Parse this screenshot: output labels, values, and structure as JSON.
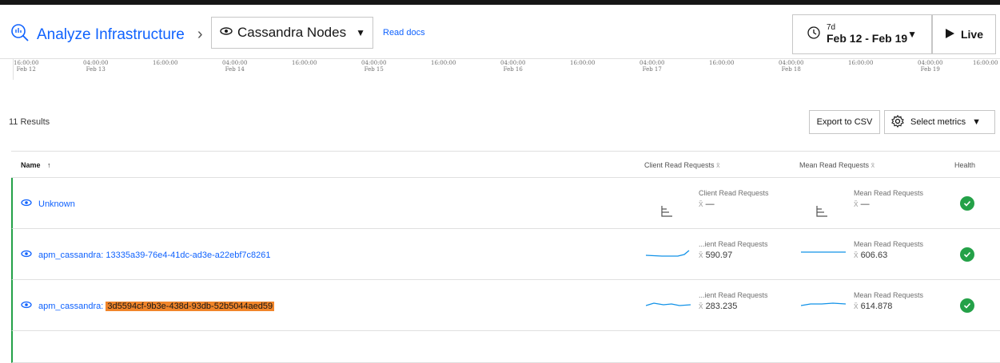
{
  "header": {
    "breadcrumb_root": "Analyze Infrastructure",
    "entity_type": "Cassandra Nodes",
    "read_docs": "Read docs",
    "time_range_short": "7d",
    "time_range": "Feb 12 - Feb 19",
    "live_label": "Live"
  },
  "timeline": {
    "ticks": [
      {
        "time": "16:00:00",
        "date": "Feb 12"
      },
      {
        "time": "04:00:00",
        "date": "Feb 13"
      },
      {
        "time": "16:00:00",
        "date": ""
      },
      {
        "time": "04:00:00",
        "date": "Feb 14"
      },
      {
        "time": "16:00:00",
        "date": ""
      },
      {
        "time": "04:00:00",
        "date": "Feb 15"
      },
      {
        "time": "16:00:00",
        "date": ""
      },
      {
        "time": "04:00:00",
        "date": "Feb 16"
      },
      {
        "time": "16:00:00",
        "date": ""
      },
      {
        "time": "04:00:00",
        "date": "Feb 17"
      },
      {
        "time": "16:00:00",
        "date": ""
      },
      {
        "time": "04:00:00",
        "date": "Feb 18"
      },
      {
        "time": "16:00:00",
        "date": ""
      },
      {
        "time": "04:00:00",
        "date": "Feb 19"
      },
      {
        "time": "16:00:00",
        "date": ""
      }
    ]
  },
  "toolbar": {
    "results_count": "11 Results",
    "export_label": "Export to CSV",
    "select_metrics_label": "Select metrics"
  },
  "table": {
    "columns": {
      "name": "Name",
      "client_read": "Client Read Requests",
      "mean_read": "Mean Read Requests",
      "health": "Health"
    },
    "rows": [
      {
        "name_prefix": "Unknown",
        "name_id": "",
        "client_label": "Client Read Requests",
        "client_value": "—",
        "mean_label": "Mean Read Requests",
        "mean_value": "—",
        "health": "healthy"
      },
      {
        "name_prefix": "apm_cassandra: ",
        "name_id": "13335a39-76e4-41dc-ad3e-a22ebf7c8261",
        "client_label": "...ient Read Requests",
        "client_value": "590.97",
        "mean_label": "Mean Read Requests",
        "mean_value": "606.63",
        "health": "healthy"
      },
      {
        "name_prefix": "apm_cassandra: ",
        "name_id": "3d5594cf-9b3e-438d-93db-52b5044aed59",
        "client_label": "...ient Read Requests",
        "client_value": "283.235",
        "mean_label": "Mean Read Requests",
        "mean_value": "614.878",
        "health": "healthy"
      }
    ]
  },
  "colors": {
    "accent": "#0f62fe",
    "healthy": "#24a148",
    "highlight": "#f1852a"
  }
}
